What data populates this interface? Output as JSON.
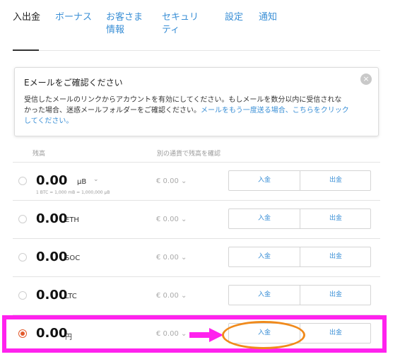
{
  "tabs": [
    {
      "label": "入出金",
      "active": true
    },
    {
      "label": "ボーナス"
    },
    {
      "label_line1": "お客さま",
      "label_line2": "情報"
    },
    {
      "label_line1": "セキュリ",
      "label_line2": "ティ"
    },
    {
      "label": "設定"
    },
    {
      "label": "通知"
    }
  ],
  "notice": {
    "title": "Eメールをご確認ください",
    "body_line1": "受信したメールのリンクからアカウントを有効にしてください。もしメールを数分以内に受信されな",
    "body_line2_text": "かった場合、迷惑メールフォルダーをご確認ください。",
    "link_part1": "メールをもう一度送る場合、こちらをクリック",
    "link_part2": "してください。",
    "close_glyph": "×"
  },
  "table": {
    "col_balance": "残高",
    "col_other": "別の通貨で残高を確認",
    "deposit_label": "入金",
    "withdraw_label": "出金",
    "chevron": "⌄",
    "rows": [
      {
        "amount": "0.00",
        "unit": "μB",
        "has_chevron": true,
        "subnote": "1 BTC = 1,000 mB = 1,000,000 μB",
        "eur": "€ 0.00",
        "selected": false
      },
      {
        "amount": "0.00",
        "unit": "ETH",
        "eur": "€ 0.00",
        "selected": false
      },
      {
        "amount": "0.00",
        "unit": "SOC",
        "eur": "€ 0.00",
        "selected": false
      },
      {
        "amount": "0.00",
        "unit": "LTC",
        "eur": "€ 0.00",
        "selected": false
      },
      {
        "amount": "0.00",
        "unit": "円",
        "eur": "€ 0.00",
        "selected": true
      }
    ]
  },
  "colors": {
    "link": "#3a8fd6",
    "highlight": "#ff22ee",
    "circle": "#f08a1c",
    "radio_selected": "#e25a2c"
  }
}
